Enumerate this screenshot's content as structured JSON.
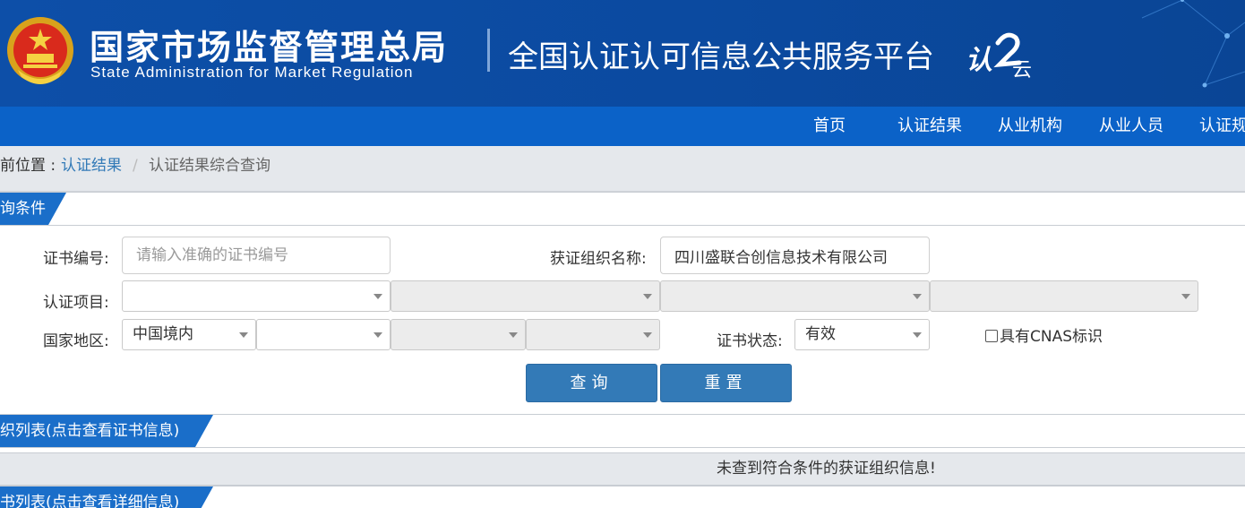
{
  "header": {
    "org_cn": "国家市场监督管理总局",
    "org_en": "State Administration  for  Market Regulation",
    "platform_title": "全国认证认可信息公共服务平台",
    "logo_text": "认",
    "logo_sub": "云",
    "colors": {
      "header_bg": "#0d4fa8",
      "nav_bg": "#0b62c8",
      "accent": "#1a6ec9"
    }
  },
  "nav": {
    "items": [
      {
        "label": "首页"
      },
      {
        "label": "认证结果"
      },
      {
        "label": "从业机构"
      },
      {
        "label": "从业人员"
      },
      {
        "label": "认证规"
      }
    ]
  },
  "breadcrumb": {
    "prefix": "前位置 :",
    "link": "认证结果",
    "separator": "/",
    "current": "认证结果综合查询"
  },
  "sections": {
    "query": "询条件",
    "org_list": "织列表(点击查看证书信息)",
    "cert_list": "书列表(点击查看详细信息)"
  },
  "form": {
    "cert_no_label": "证书编号:",
    "cert_no_placeholder": "请输入准确的证书编号",
    "cert_no_value": "",
    "org_name_label": "获证组织名称:",
    "org_name_value": "四川盛联合创信息技术有限公司",
    "project_label": "认证项目:",
    "project_selects": [
      "",
      "",
      "",
      ""
    ],
    "region_label": "国家地区:",
    "region_selects": [
      "中国境内",
      "",
      "",
      ""
    ],
    "status_label": "证书状态:",
    "status_value": "有效",
    "cnas_label": "具有CNAS标识",
    "cnas_checked": false
  },
  "buttons": {
    "query": "查询",
    "reset": "重置"
  },
  "results": {
    "empty_message": "未查到符合条件的获证组织信息!"
  }
}
